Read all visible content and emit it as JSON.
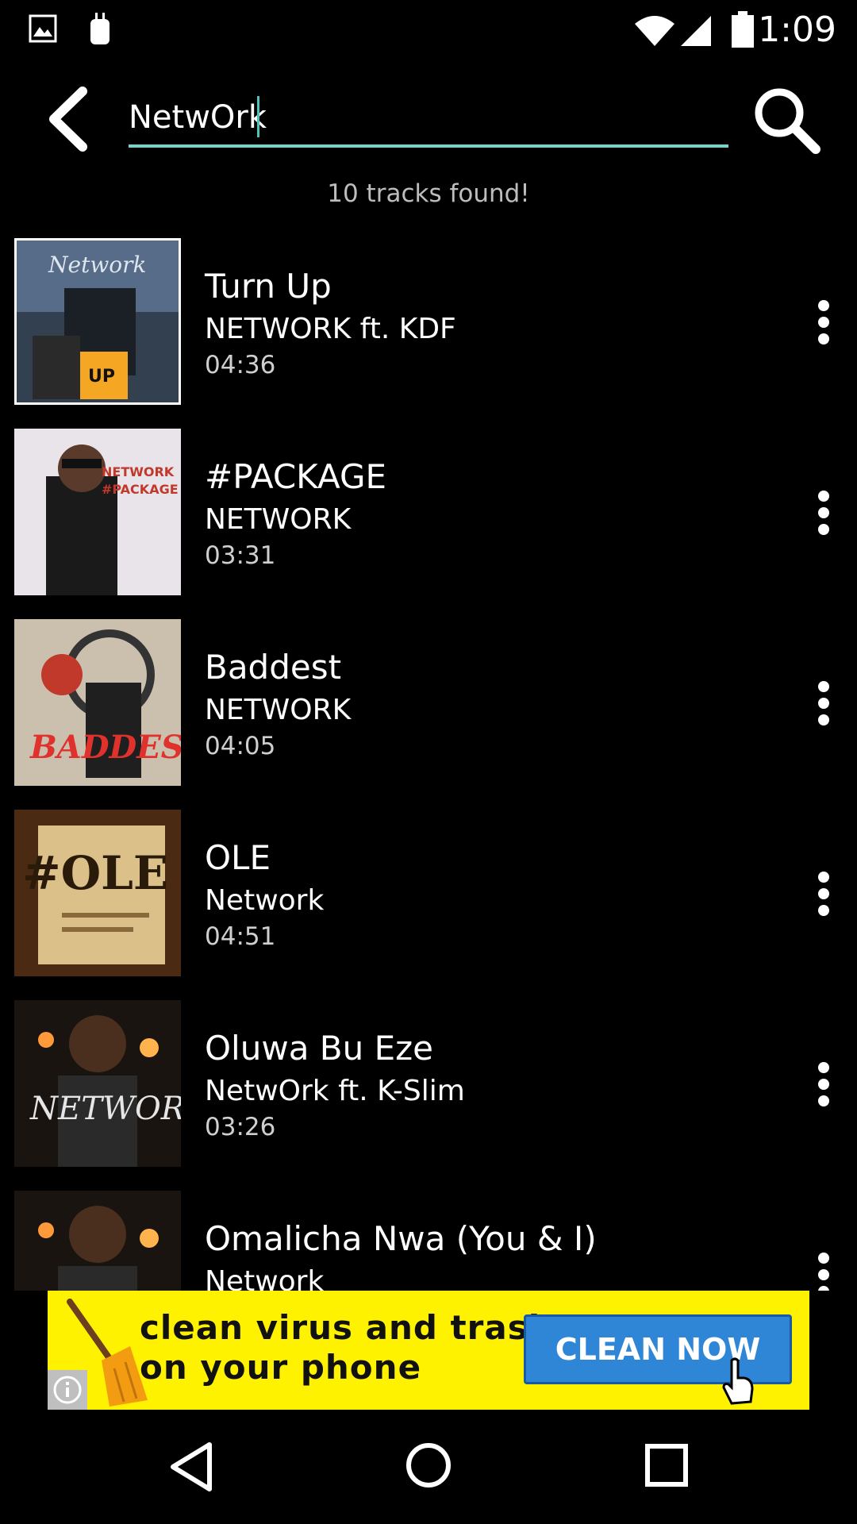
{
  "status_bar": {
    "time": "1:09",
    "icons": [
      "gallery-icon",
      "app-notification-icon",
      "wifi-icon",
      "signal-icon",
      "battery-icon"
    ]
  },
  "search": {
    "value": "NetwOrk",
    "back_icon": "back-arrow-icon",
    "search_icon": "search-icon"
  },
  "result_count": "10 tracks found!",
  "tracks": [
    {
      "title": "Turn Up",
      "artist": "NETWORK ft. KDF",
      "duration": "04:36"
    },
    {
      "title": "#PACKAGE",
      "artist": "NETWORK",
      "duration": "03:31"
    },
    {
      "title": "Baddest",
      "artist": "NETWORK",
      "duration": "04:05"
    },
    {
      "title": "OLE",
      "artist": "Network",
      "duration": "04:51"
    },
    {
      "title": "Oluwa Bu Eze",
      "artist": "NetwOrk ft. K-Slim",
      "duration": "03:26"
    },
    {
      "title": "Omalicha Nwa (You & I)",
      "artist": "Network",
      "duration": ""
    }
  ],
  "ad": {
    "line1": "clean virus and trash",
    "line2": "on your phone",
    "cta": "CLEAN NOW",
    "bg_color": "#fff200",
    "cta_color": "#2f86d6"
  },
  "nav": {
    "back_icon": "nav-back-icon",
    "home_icon": "nav-home-icon",
    "recents_icon": "nav-recents-icon"
  },
  "colors": {
    "accent": "#7fd0c7",
    "background": "#000000"
  }
}
